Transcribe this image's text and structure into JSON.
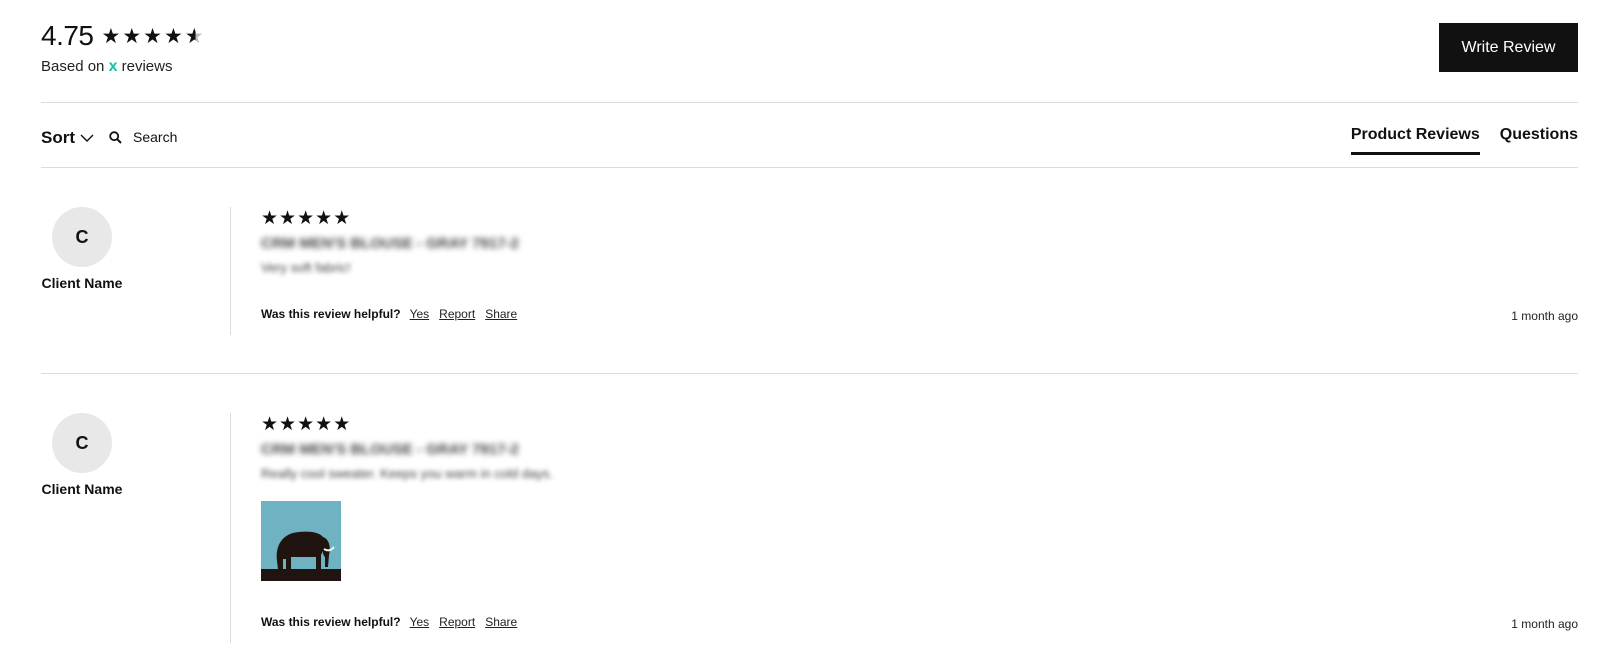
{
  "summary": {
    "rating": "4.75",
    "stars": 4.75,
    "based_prefix": "Based on",
    "based_count": "x",
    "based_suffix": "reviews"
  },
  "header": {
    "write_review_label": "Write Review"
  },
  "toolbar": {
    "sort_label": "Sort",
    "search_placeholder": "Search",
    "tabs": [
      {
        "label": "Product Reviews",
        "active": true
      },
      {
        "label": "Questions",
        "active": false
      }
    ]
  },
  "reviews": [
    {
      "initial": "C",
      "author": "Client Name",
      "stars": 5,
      "title": "CRM MEN'S BLOUSE - GRAY 7917-2",
      "text": "Very soft fabric!",
      "helpful_question": "Was this review helpful?",
      "yes_label": "Yes",
      "report_label": "Report",
      "share_label": "Share",
      "time": "1 month ago",
      "has_photo": false
    },
    {
      "initial": "C",
      "author": "Client Name",
      "stars": 5,
      "title": "CRM MEN'S BLOUSE - GRAY 7917-2",
      "text": "Really cool sweater. Keeps you warm in cold days.",
      "helpful_question": "Was this review helpful?",
      "yes_label": "Yes",
      "report_label": "Report",
      "share_label": "Share",
      "time": "1 month ago",
      "has_photo": true,
      "photo_icon": "elephant-photo"
    }
  ],
  "colors": {
    "accent": "#15c3a8",
    "button_bg": "#111111",
    "divider": "#dcdcdc",
    "avatar_bg": "#e8e8e8",
    "photo_sky": "#6fb2c2"
  }
}
